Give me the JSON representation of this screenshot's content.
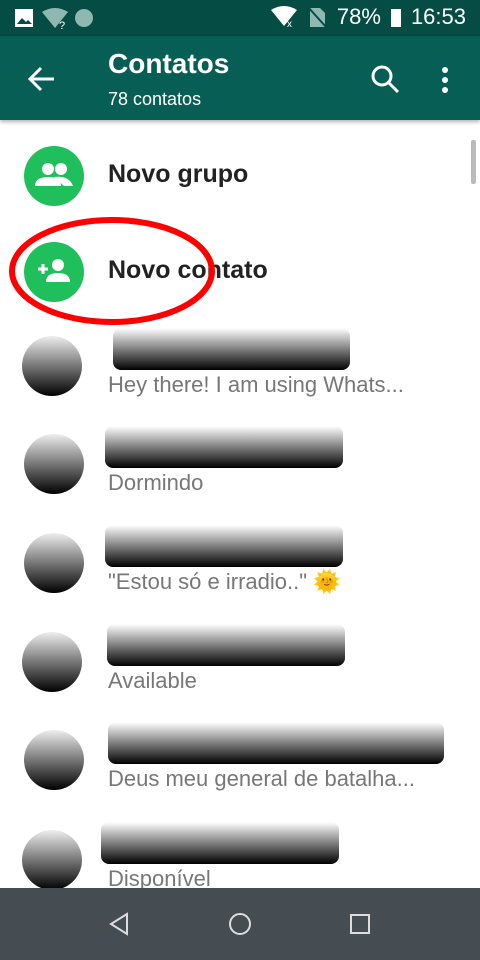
{
  "status_bar": {
    "battery": "78%",
    "time": "16:53"
  },
  "toolbar": {
    "title": "Contatos",
    "subtitle": "78 contatos"
  },
  "actions": [
    {
      "label": "Novo grupo"
    },
    {
      "label": "Novo contato"
    }
  ],
  "contacts": [
    {
      "status": "Hey there! I am using Whats..."
    },
    {
      "status": "Dormindo"
    },
    {
      "status": "\"Estou só e irradio..\" 🌞"
    },
    {
      "status": "Available"
    },
    {
      "status": "Deus meu general de batalha..."
    },
    {
      "status": "Disponível"
    }
  ],
  "colors": {
    "status_bar": "#054c44",
    "toolbar": "#075e54",
    "accent": "#1fc05b",
    "annotation": "#ff0000"
  }
}
